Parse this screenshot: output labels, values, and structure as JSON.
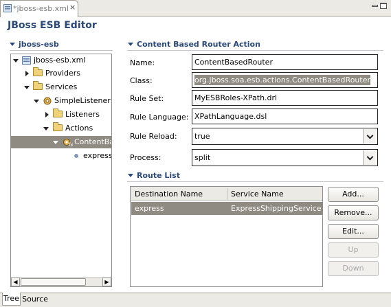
{
  "editor_tab": {
    "label": "*jboss-esb.xml",
    "close": "×"
  },
  "header": {
    "title": "JBoss ESB Editor"
  },
  "tree_section": {
    "title": "jboss-esb"
  },
  "tree": {
    "root": "jboss-esb.xml",
    "providers": "Providers",
    "services": "Services",
    "simple_listener": "SimpleListener",
    "listeners": "Listeners",
    "actions": "Actions",
    "content_based": "ContentBa",
    "express": "express"
  },
  "action_section": {
    "title": "Content Based Router Action"
  },
  "form": {
    "name_label": "Name:",
    "name_value": "ContentBasedRouter",
    "class_label": "Class:",
    "class_value": "org.jboss.soa.esb.actions.ContentBasedRouter",
    "ruleset_label": "Rule Set:",
    "ruleset_value": "MyESBRoles-XPath.drl",
    "rulelang_label": "Rule Language:",
    "rulelang_value": "XPathLanguage.dsl",
    "reload_label": "Rule Reload:",
    "reload_value": "true",
    "process_label": "Process:",
    "process_value": "split"
  },
  "route_section": {
    "title": "Route List"
  },
  "route_table": {
    "columns": [
      "Destination Name",
      "Service Name"
    ],
    "rows": [
      {
        "destination": "express",
        "service": "ExpressShippingService"
      }
    ]
  },
  "buttons": {
    "add": "Add...",
    "remove": "Remove...",
    "edit": "Edit...",
    "up": "Up",
    "down": "Down"
  },
  "bottom_tabs": {
    "tree": "Tree",
    "source": "Source"
  },
  "colors": {
    "accent_title": "#2b4a7a",
    "selection": "#8f8a82"
  }
}
